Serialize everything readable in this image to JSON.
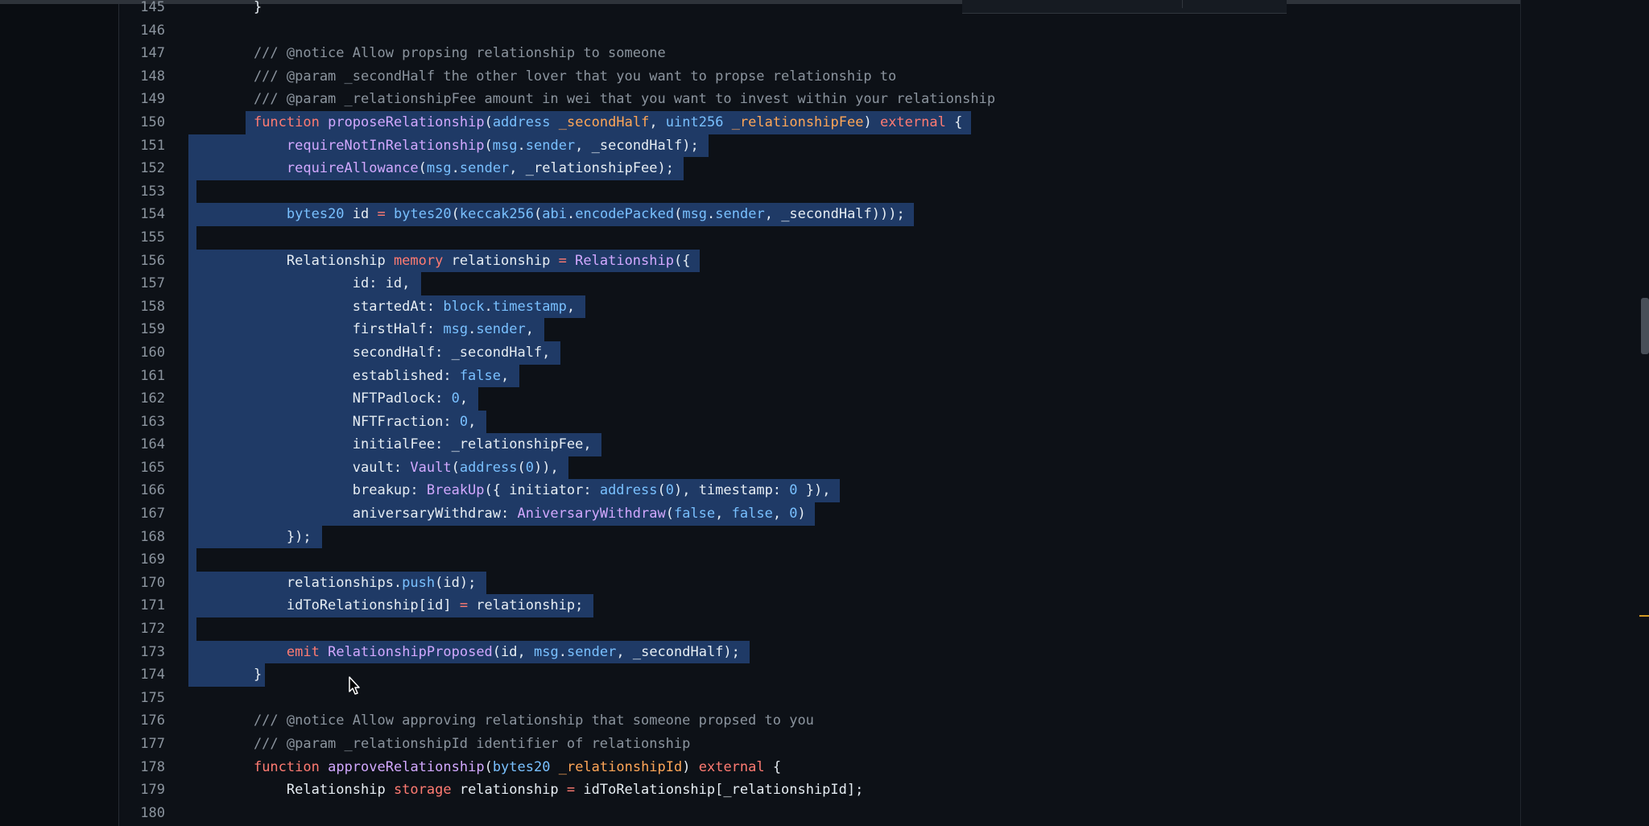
{
  "editor": {
    "lines": [
      {
        "num": "145",
        "tokens": [
          {
            "t": "    }",
            "c": ""
          }
        ]
      },
      {
        "num": "146",
        "tokens": []
      },
      {
        "num": "147",
        "tokens": [
          {
            "t": "    /// @notice Allow propsing relationship to someone",
            "c": "c"
          }
        ]
      },
      {
        "num": "148",
        "tokens": [
          {
            "t": "    /// @param _secondHalf the other lover that you want to propse relationship to",
            "c": "c"
          }
        ]
      },
      {
        "num": "149",
        "tokens": [
          {
            "t": "    /// @param _relationshipFee amount in wei that you want to invest within your relationship",
            "c": "c"
          }
        ]
      },
      {
        "num": "150",
        "tokens": [
          {
            "t": "    ",
            "c": ""
          },
          {
            "t": "function",
            "c": "k"
          },
          {
            "t": " ",
            "c": ""
          },
          {
            "t": "proposeRelationship",
            "c": "f"
          },
          {
            "t": "(",
            "c": ""
          },
          {
            "t": "address",
            "c": "t"
          },
          {
            "t": " ",
            "c": ""
          },
          {
            "t": "_secondHalf",
            "c": "p"
          },
          {
            "t": ", ",
            "c": ""
          },
          {
            "t": "uint256",
            "c": "t"
          },
          {
            "t": " ",
            "c": ""
          },
          {
            "t": "_relationshipFee",
            "c": "p"
          },
          {
            "t": ") ",
            "c": ""
          },
          {
            "t": "external",
            "c": "k"
          },
          {
            "t": " {",
            "c": ""
          }
        ]
      },
      {
        "num": "151",
        "tokens": [
          {
            "t": "        ",
            "c": ""
          },
          {
            "t": "requireNotInRelationship",
            "c": "f"
          },
          {
            "t": "(",
            "c": ""
          },
          {
            "t": "msg",
            "c": "t"
          },
          {
            "t": ".",
            "c": ""
          },
          {
            "t": "sender",
            "c": "t"
          },
          {
            "t": ", _secondHalf);",
            "c": ""
          }
        ]
      },
      {
        "num": "152",
        "tokens": [
          {
            "t": "        ",
            "c": ""
          },
          {
            "t": "requireAllowance",
            "c": "f"
          },
          {
            "t": "(",
            "c": ""
          },
          {
            "t": "msg",
            "c": "t"
          },
          {
            "t": ".",
            "c": ""
          },
          {
            "t": "sender",
            "c": "t"
          },
          {
            "t": ", _relationshipFee);",
            "c": ""
          }
        ]
      },
      {
        "num": "153",
        "tokens": []
      },
      {
        "num": "154",
        "tokens": [
          {
            "t": "        ",
            "c": ""
          },
          {
            "t": "bytes20",
            "c": "t"
          },
          {
            "t": " id ",
            "c": ""
          },
          {
            "t": "=",
            "c": "k"
          },
          {
            "t": " ",
            "c": ""
          },
          {
            "t": "bytes20",
            "c": "t"
          },
          {
            "t": "(",
            "c": ""
          },
          {
            "t": "keccak256",
            "c": "t"
          },
          {
            "t": "(",
            "c": ""
          },
          {
            "t": "abi",
            "c": "t"
          },
          {
            "t": ".",
            "c": ""
          },
          {
            "t": "encodePacked",
            "c": "t"
          },
          {
            "t": "(",
            "c": ""
          },
          {
            "t": "msg",
            "c": "t"
          },
          {
            "t": ".",
            "c": ""
          },
          {
            "t": "sender",
            "c": "t"
          },
          {
            "t": ", _secondHalf)));",
            "c": ""
          }
        ]
      },
      {
        "num": "155",
        "tokens": []
      },
      {
        "num": "156",
        "tokens": [
          {
            "t": "        Relationship ",
            "c": ""
          },
          {
            "t": "memory",
            "c": "k"
          },
          {
            "t": " relationship ",
            "c": ""
          },
          {
            "t": "=",
            "c": "k"
          },
          {
            "t": " ",
            "c": ""
          },
          {
            "t": "Relationship",
            "c": "f"
          },
          {
            "t": "({",
            "c": ""
          }
        ]
      },
      {
        "num": "157",
        "tokens": [
          {
            "t": "                id: id,",
            "c": ""
          }
        ]
      },
      {
        "num": "158",
        "tokens": [
          {
            "t": "                startedAt: ",
            "c": ""
          },
          {
            "t": "block",
            "c": "t"
          },
          {
            "t": ".",
            "c": ""
          },
          {
            "t": "timestamp",
            "c": "t"
          },
          {
            "t": ",",
            "c": ""
          }
        ]
      },
      {
        "num": "159",
        "tokens": [
          {
            "t": "                firstHalf: ",
            "c": ""
          },
          {
            "t": "msg",
            "c": "t"
          },
          {
            "t": ".",
            "c": ""
          },
          {
            "t": "sender",
            "c": "t"
          },
          {
            "t": ",",
            "c": ""
          }
        ]
      },
      {
        "num": "160",
        "tokens": [
          {
            "t": "                secondHalf: _secondHalf,",
            "c": ""
          }
        ]
      },
      {
        "num": "161",
        "tokens": [
          {
            "t": "                established: ",
            "c": ""
          },
          {
            "t": "false",
            "c": "n"
          },
          {
            "t": ",",
            "c": ""
          }
        ]
      },
      {
        "num": "162",
        "tokens": [
          {
            "t": "                NFTPadlock: ",
            "c": ""
          },
          {
            "t": "0",
            "c": "n"
          },
          {
            "t": ",",
            "c": ""
          }
        ]
      },
      {
        "num": "163",
        "tokens": [
          {
            "t": "                NFTFraction: ",
            "c": ""
          },
          {
            "t": "0",
            "c": "n"
          },
          {
            "t": ",",
            "c": ""
          }
        ]
      },
      {
        "num": "164",
        "tokens": [
          {
            "t": "                initialFee: _relationshipFee,",
            "c": ""
          }
        ]
      },
      {
        "num": "165",
        "tokens": [
          {
            "t": "                vault: ",
            "c": ""
          },
          {
            "t": "Vault",
            "c": "f"
          },
          {
            "t": "(",
            "c": ""
          },
          {
            "t": "address",
            "c": "t"
          },
          {
            "t": "(",
            "c": ""
          },
          {
            "t": "0",
            "c": "n"
          },
          {
            "t": ")),",
            "c": ""
          }
        ]
      },
      {
        "num": "166",
        "tokens": [
          {
            "t": "                breakup: ",
            "c": ""
          },
          {
            "t": "BreakUp",
            "c": "f"
          },
          {
            "t": "({ initiator: ",
            "c": ""
          },
          {
            "t": "address",
            "c": "t"
          },
          {
            "t": "(",
            "c": ""
          },
          {
            "t": "0",
            "c": "n"
          },
          {
            "t": "), timestamp: ",
            "c": ""
          },
          {
            "t": "0",
            "c": "n"
          },
          {
            "t": " }),",
            "c": ""
          }
        ]
      },
      {
        "num": "167",
        "tokens": [
          {
            "t": "                aniversaryWithdraw: ",
            "c": ""
          },
          {
            "t": "AniversaryWithdraw",
            "c": "f"
          },
          {
            "t": "(",
            "c": ""
          },
          {
            "t": "false",
            "c": "n"
          },
          {
            "t": ", ",
            "c": ""
          },
          {
            "t": "false",
            "c": "n"
          },
          {
            "t": ", ",
            "c": ""
          },
          {
            "t": "0",
            "c": "n"
          },
          {
            "t": ")",
            "c": ""
          }
        ]
      },
      {
        "num": "168",
        "tokens": [
          {
            "t": "        });",
            "c": ""
          }
        ]
      },
      {
        "num": "169",
        "tokens": []
      },
      {
        "num": "170",
        "tokens": [
          {
            "t": "        relationships.",
            "c": ""
          },
          {
            "t": "push",
            "c": "t"
          },
          {
            "t": "(id);",
            "c": ""
          }
        ]
      },
      {
        "num": "171",
        "tokens": [
          {
            "t": "        idToRelationship[id] ",
            "c": ""
          },
          {
            "t": "=",
            "c": "k"
          },
          {
            "t": " relationship;",
            "c": ""
          }
        ]
      },
      {
        "num": "172",
        "tokens": []
      },
      {
        "num": "173",
        "tokens": [
          {
            "t": "        ",
            "c": ""
          },
          {
            "t": "emit",
            "c": "k"
          },
          {
            "t": " ",
            "c": ""
          },
          {
            "t": "RelationshipProposed",
            "c": "f"
          },
          {
            "t": "(id, ",
            "c": ""
          },
          {
            "t": "msg",
            "c": "t"
          },
          {
            "t": ".",
            "c": ""
          },
          {
            "t": "sender",
            "c": "t"
          },
          {
            "t": ", _secondHalf);",
            "c": ""
          }
        ]
      },
      {
        "num": "174",
        "tokens": [
          {
            "t": "    }",
            "c": ""
          }
        ]
      },
      {
        "num": "175",
        "tokens": []
      },
      {
        "num": "176",
        "tokens": [
          {
            "t": "    /// @notice Allow approving relationship that someone propsed to you",
            "c": "c"
          }
        ]
      },
      {
        "num": "177",
        "tokens": [
          {
            "t": "    /// @param _relationshipId identifier of relationship",
            "c": "c"
          }
        ]
      },
      {
        "num": "178",
        "tokens": [
          {
            "t": "    ",
            "c": ""
          },
          {
            "t": "function",
            "c": "k"
          },
          {
            "t": " ",
            "c": ""
          },
          {
            "t": "approveRelationship",
            "c": "f"
          },
          {
            "t": "(",
            "c": ""
          },
          {
            "t": "bytes20",
            "c": "t"
          },
          {
            "t": " ",
            "c": ""
          },
          {
            "t": "_relationshipId",
            "c": "p"
          },
          {
            "t": ") ",
            "c": ""
          },
          {
            "t": "external",
            "c": "k"
          },
          {
            "t": " {",
            "c": ""
          }
        ]
      },
      {
        "num": "179",
        "tokens": [
          {
            "t": "        Relationship ",
            "c": ""
          },
          {
            "t": "storage",
            "c": "k"
          },
          {
            "t": " relationship ",
            "c": ""
          },
          {
            "t": "=",
            "c": "k"
          },
          {
            "t": " idToRelationship[_relationshipId];",
            "c": ""
          }
        ]
      },
      {
        "num": "180",
        "tokens": []
      }
    ],
    "selection": {
      "from_line": "150",
      "to_line": "174"
    }
  }
}
